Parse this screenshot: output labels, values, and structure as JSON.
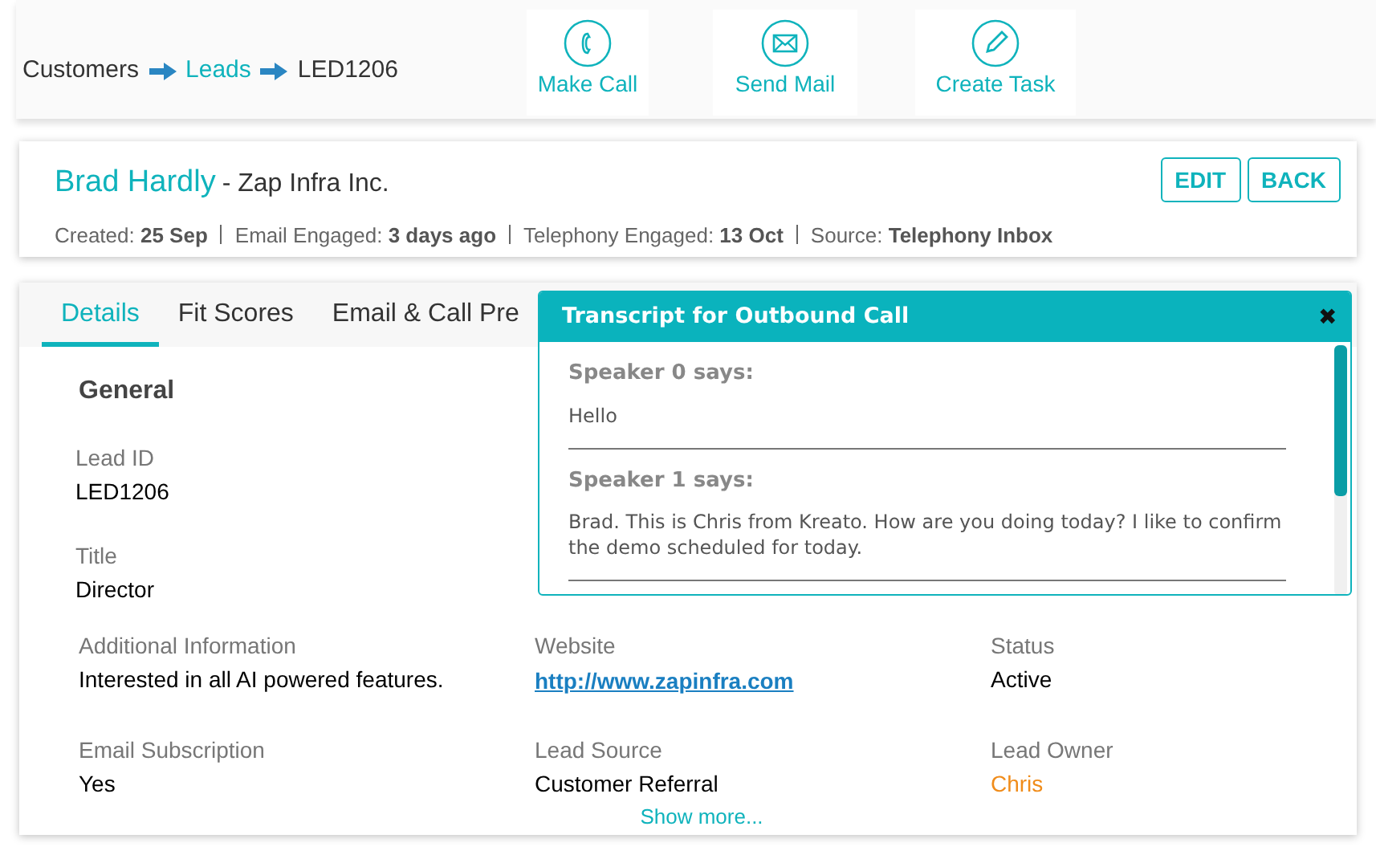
{
  "breadcrumb": [
    {
      "label": "Customers",
      "link": false
    },
    {
      "label": "Leads",
      "link": true
    },
    {
      "label": "LED1206",
      "link": false
    }
  ],
  "actions": [
    {
      "kind": "phone",
      "label": "Make Call"
    },
    {
      "kind": "mail",
      "label": "Send Mail"
    },
    {
      "kind": "pencil",
      "label": "Create Task"
    }
  ],
  "lead": {
    "name": "Brad Hardly",
    "company": "- Zap Infra Inc.",
    "buttons": [
      "EDIT",
      "BACK"
    ],
    "meta": [
      {
        "label": "Created:",
        "value": "25 Sep"
      },
      {
        "label": "Email Engaged:",
        "value": "3 days ago"
      },
      {
        "label": "Telephony Engaged:",
        "value": "13 Oct"
      },
      {
        "label": "Source:",
        "value": "Telephony Inbox"
      }
    ]
  },
  "tabs": [
    {
      "label": "Details",
      "selected": true
    },
    {
      "label": "Fit Scores",
      "selected": false
    },
    {
      "label": "Email & Call Pre",
      "selected": false
    }
  ],
  "section_title": "General",
  "top_fields": [
    {
      "label": "Lead ID",
      "value": "LED1206"
    },
    {
      "label": "Title",
      "value": "Director"
    }
  ],
  "fields": [
    {
      "label": "Additional Information",
      "value": "Interested in all AI powered features.",
      "kind": "text"
    },
    {
      "label": "Website",
      "value": "http://www.zapinfra.com",
      "kind": "link"
    },
    {
      "label": "Status",
      "value": "Active",
      "kind": "text"
    },
    {
      "label": "Email Subscription",
      "value": "Yes",
      "kind": "text"
    },
    {
      "label": "Lead Source",
      "value": "Customer Referral",
      "kind": "text"
    },
    {
      "label": "Lead Owner",
      "value": "Chris",
      "kind": "owner"
    }
  ],
  "show_more": "Show more...",
  "transcript": {
    "title": "Transcript for Outbound Call",
    "close": "✖",
    "entries": [
      {
        "speaker": "Speaker 0 says:",
        "text": "Hello"
      },
      {
        "speaker": "Speaker 1 says:",
        "text": "Brad. This is Chris from Kreato. How are you doing today? I like to confirm the demo scheduled for today."
      }
    ]
  }
}
